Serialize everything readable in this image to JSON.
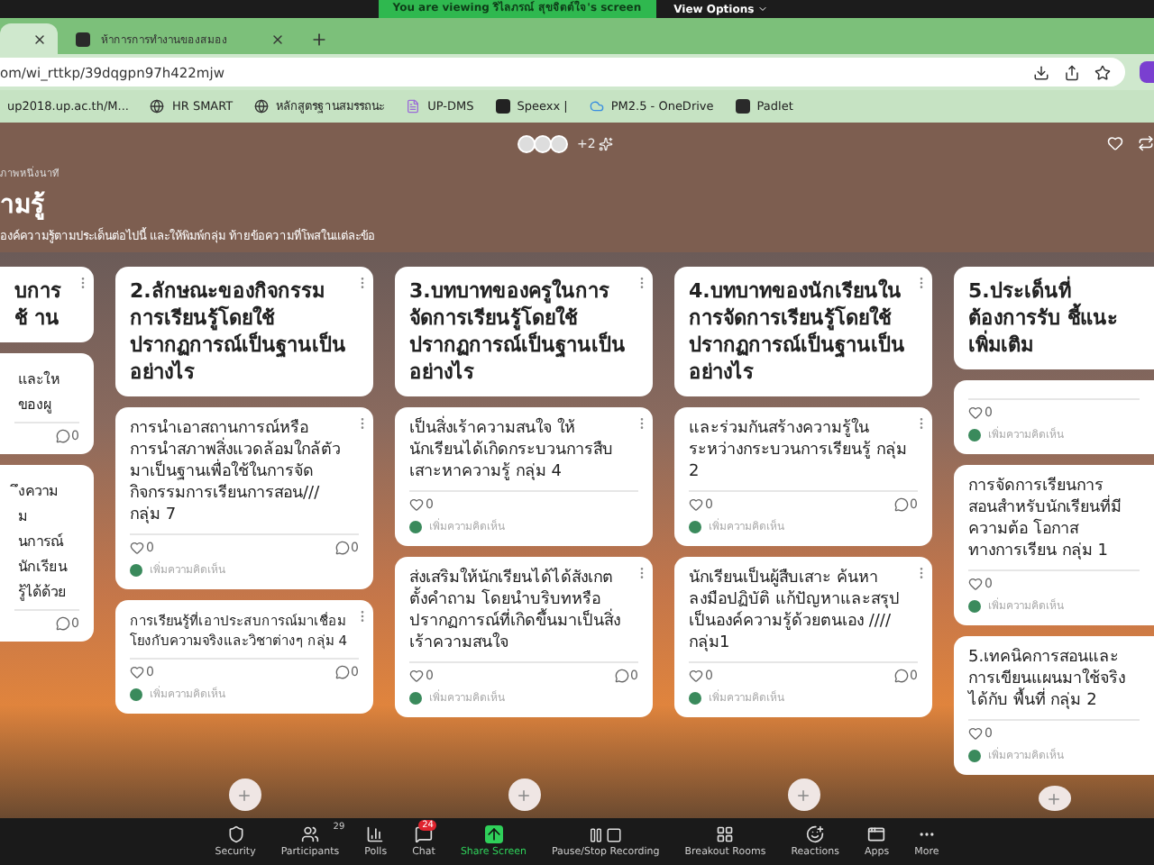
{
  "zoom_banner": {
    "text": "You are viewing ริไลภรณ์ สุขจิตต์ใจ's screen",
    "view_options": "View Options"
  },
  "browser": {
    "tabs": [
      {
        "selected": true
      },
      {
        "title": "ห้าการการทำงานของสมอง",
        "selected": false
      }
    ],
    "url": "om/wi_rttkp/39dqgpn97h422mjw",
    "bookmarks": [
      {
        "kind": "text",
        "label": "up2018.up.ac.th/M..."
      },
      {
        "kind": "globe",
        "label": "HR SMART"
      },
      {
        "kind": "globe",
        "label": "หลักสูตรฐานสมรรถนะ"
      },
      {
        "kind": "doc",
        "label": "UP-DMS"
      },
      {
        "kind": "x",
        "label": "Speexx |"
      },
      {
        "kind": "cloud",
        "label": "PM2.5 - OneDrive"
      },
      {
        "kind": "padlet",
        "label": "Padlet"
      }
    ]
  },
  "padlet": {
    "extra_viewers": "+2",
    "subtitle": "ภาพหนึ่งนาที",
    "title": "ามรู้",
    "description": "องค์ความรู้ตามประเด็นต่อไปนี้ และให้พิมพ์กลุ่ม ท้ายข้อความที่โพสในแต่ละข้อ",
    "columns": [
      {
        "kind": "cut",
        "header": "บการ ช้ าน",
        "posts": [
          {
            "lines": [
              "และให",
              "ของผู"
            ],
            "comments": "0"
          },
          {
            "lines": [
              "ึงความ",
              "ม",
              "นการณ์",
              "นักเรียน",
              "รู้ได้ด้วย"
            ],
            "comments": "0"
          }
        ]
      },
      {
        "kind": "full",
        "header": "2.ลักษณะของกิจกรรมการเรียนรู้โดยใช้ปรากฏการณ์เป็นฐานเป็นอย่างไร",
        "posts": [
          {
            "text": "การนำเอาสถานการณ์หรือการนำสภาพสิ่งแวดล้อมใกล้ตัวมาเป็นฐานเพื่อใช้ในการจัดกิจกรรมการเรียนการสอน/// กลุ่ม 7",
            "likes": "0",
            "comments": "0",
            "comment_placeholder": "เพิ่มความคิดเห็น"
          },
          {
            "text": "การเรียนรู้ที่เอาประสบการณ์มาเชื่อมโยงกับความจริงและวิชาต่างๆ กลุ่ม 4",
            "small": true,
            "likes": "0",
            "comments": "0",
            "comment_placeholder": "เพิ่มความคิดเห็น"
          }
        ]
      },
      {
        "kind": "full",
        "header": "3.บทบาทของครูในการจัดการเรียนรู้โดยใช้ปรากฏการณ์เป็นฐานเป็นอย่างไร",
        "posts": [
          {
            "text": "เป็นสิ่งเร้าความสนใจ ให้นักเรียนได้เกิดกระบวนการสืบเสาะหาความรู้ กลุ่ม 4",
            "likes": "0",
            "comment_placeholder": "เพิ่มความคิดเห็น"
          },
          {
            "text": "ส่งเสริมให้นักเรียนได้ได้สังเกต ตั้งคำถาม โดยนำบริบทหรือปรากฏการณ์ที่เกิดขึ้นมาเป็นสิ่งเร้าความสนใจ",
            "likes": "0",
            "comments": "0",
            "comment_placeholder": "เพิ่มความคิดเห็น"
          }
        ]
      },
      {
        "kind": "full",
        "header": "4.บทบาทของนักเรียนในการจัดการเรียนรู้โดยใช้ปรากฏการณ์เป็นฐานเป็นอย่างไร",
        "posts": [
          {
            "text": "และร่วมกันสร้างความรู้ในระหว่างกระบวนการเรียนรู้ กลุ่ม 2",
            "likes": "0",
            "comments": "0",
            "comment_placeholder": "เพิ่มความคิดเห็น"
          },
          {
            "text": "นักเรียนเป็นผู้สืบเสาะ ค้นหา ลงมือปฏิบัติ แก้ปัญหาและสรุปเป็นองค์ความรู้ด้วยตนเอง //// กลุ่ม1",
            "likes": "0",
            "comments": "0",
            "comment_placeholder": "เพิ่มความคิดเห็น"
          }
        ]
      },
      {
        "kind": "edge",
        "header": "5.ประเด็นที่ต้องการรับ ชี้แนะเพิ่มเติม",
        "posts": [
          {
            "likes": "0",
            "comment_placeholder": "เพิ่มความคิดเห็น"
          },
          {
            "text": "การจัดการเรียนการสอนสำหรับนักเรียนที่มีความต้อ โอกาสทางการเรียน กลุ่ม 1",
            "likes": "0",
            "comment_placeholder": "เพิ่มความคิดเห็น"
          },
          {
            "text": "5.เทคนิคการสอนและการเขียนแผนมาใช้จริงได้กับ พื้นที่ กลุ่ม 2",
            "likes": "0",
            "comment_placeholder": "เพิ่มความคิดเห็น"
          }
        ]
      }
    ]
  },
  "toolbar": [
    {
      "kind": "security",
      "label": "Security"
    },
    {
      "kind": "participants",
      "label": "Participants",
      "count": "29"
    },
    {
      "kind": "polls",
      "label": "Polls"
    },
    {
      "kind": "chat",
      "label": "Chat",
      "badge": "24"
    },
    {
      "kind": "share",
      "label": "Share Screen"
    },
    {
      "kind": "record",
      "label": "Pause/Stop Recording"
    },
    {
      "kind": "rooms",
      "label": "Breakout Rooms"
    },
    {
      "kind": "reactions",
      "label": "Reactions"
    },
    {
      "kind": "apps",
      "label": "Apps"
    },
    {
      "kind": "more",
      "label": "More"
    }
  ]
}
